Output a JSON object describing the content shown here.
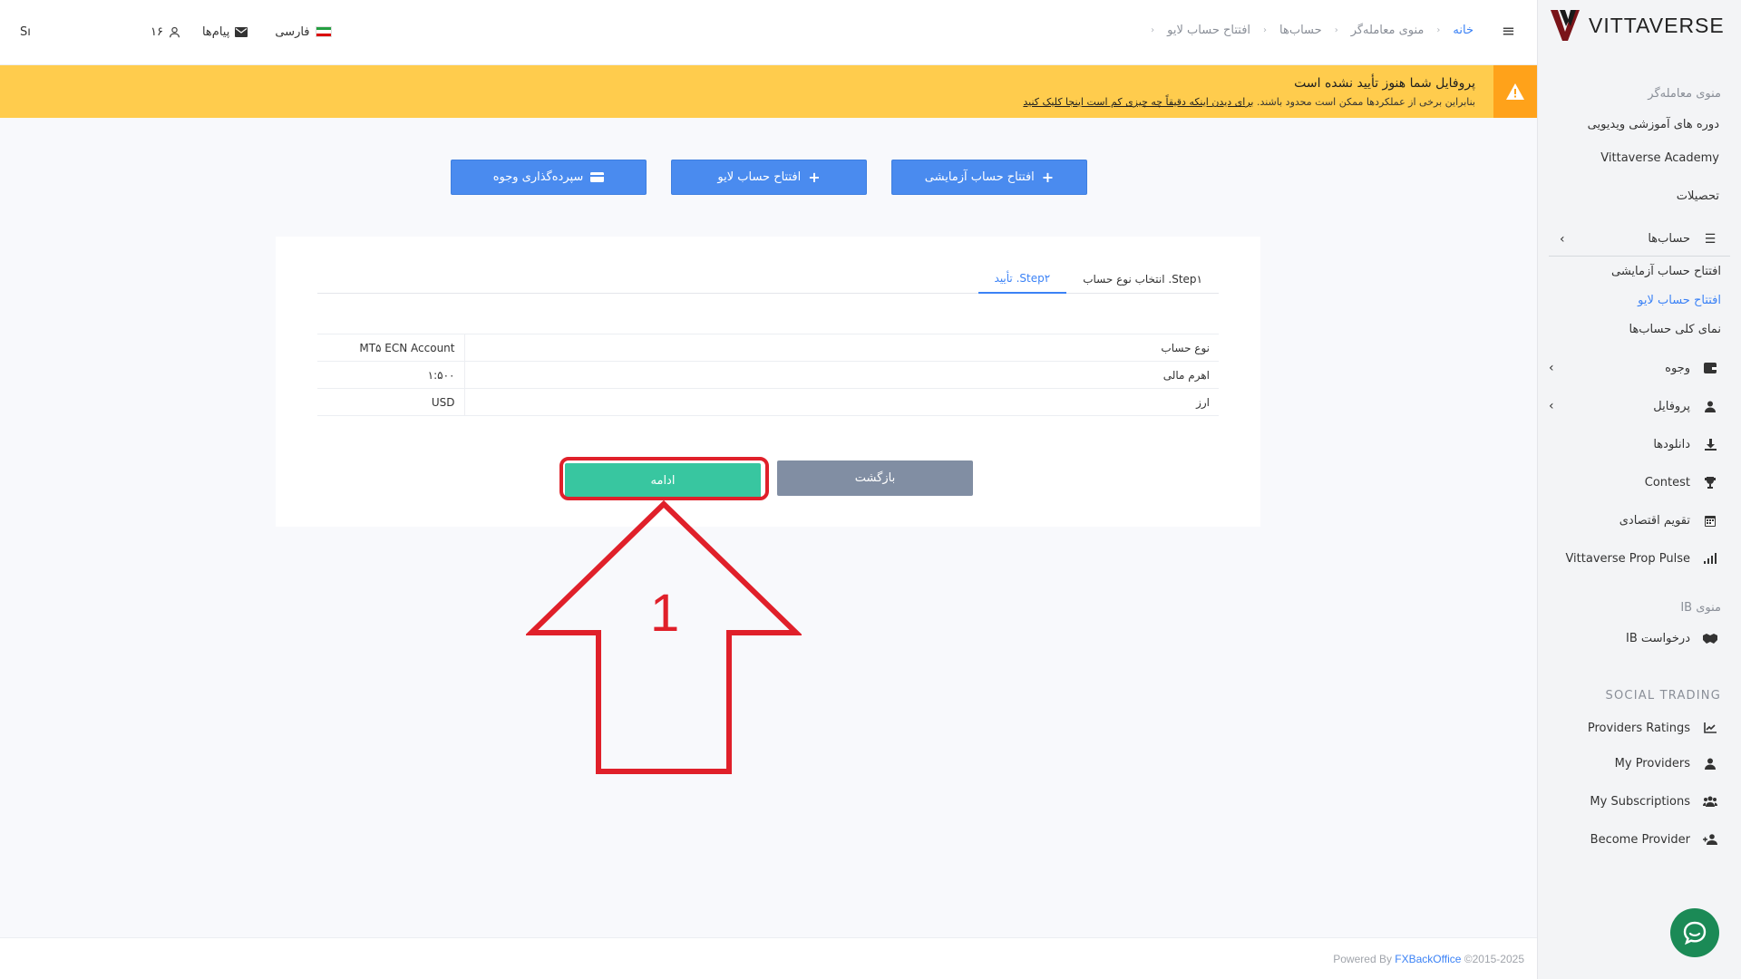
{
  "brand": {
    "name": "VITTAVERSE",
    "mark_color": "#7a1419"
  },
  "header": {
    "breadcrumb": [
      "خانه",
      "منوی معامله‌گر",
      "حساب‌ها",
      "افتتاح حساب لایو"
    ],
    "language": "فارسی",
    "messages": "پیام‌ها",
    "user_count": "۱۶",
    "search_value": "Sı"
  },
  "alert": {
    "title": "پروفایل شما هنوز تأیید نشده است",
    "desc_prefix": "بنابراین برخی از عملکردها ممکن است محدود باشند. ",
    "desc_link": "برای دیدن اینکه دقیقاً چه چیزی کم است اینجا کلیک کنید"
  },
  "actions": {
    "demo": "افتتاح حساب آزمایشی",
    "live": "افتتاح حساب لایو",
    "deposit": "سپرده‌گذاری وجوه"
  },
  "wizard": {
    "tab1": "Step۱. انتخاب نوع حساب",
    "tab2": "Step۲. تأیید",
    "rows": [
      {
        "label": "نوع حساب",
        "value": "MT۵ ECN Account"
      },
      {
        "label": "اهرم مالی",
        "value": "۱:۵۰۰"
      },
      {
        "label": "ارز",
        "value": "USD"
      }
    ],
    "continue": "ادامه",
    "back": "بازگشت"
  },
  "annotation": {
    "number": "1",
    "color": "#e0202a"
  },
  "sidebar": {
    "section_trader": "منوی معامله‌گر",
    "video_courses": "دوره های آموزشی ویدیویی",
    "academy": "Vittaverse Academy",
    "education": "تحصیلات",
    "accounts": "حساب‌ها",
    "sub_demo": "افتتاح حساب آزمایشی",
    "sub_live": "افتتاح حساب لایو",
    "sub_overview": "نمای کلی حساب‌ها",
    "funds": "وجوه",
    "profile": "پروفایل",
    "downloads": "دانلودها",
    "contest": "Contest",
    "calendar": "تقویم اقتصادی",
    "prop_pulse": "Vittaverse Prop Pulse",
    "section_ib": "منوی IB",
    "ib_request": "درخواست IB",
    "section_social": "SOCIAL TRADING",
    "providers_ratings": "Providers Ratings",
    "my_providers": "My Providers",
    "my_subscriptions": "My Subscriptions",
    "become_provider": "Become Provider"
  },
  "footer": {
    "powered": "Powered By ",
    "company": "FXBackOffice",
    "copyright": " ©2015-2025"
  },
  "colors": {
    "primary": "#4a8bef",
    "success": "#38c6a0",
    "secondary": "#818ea3",
    "warning": "#ffcc4d"
  }
}
